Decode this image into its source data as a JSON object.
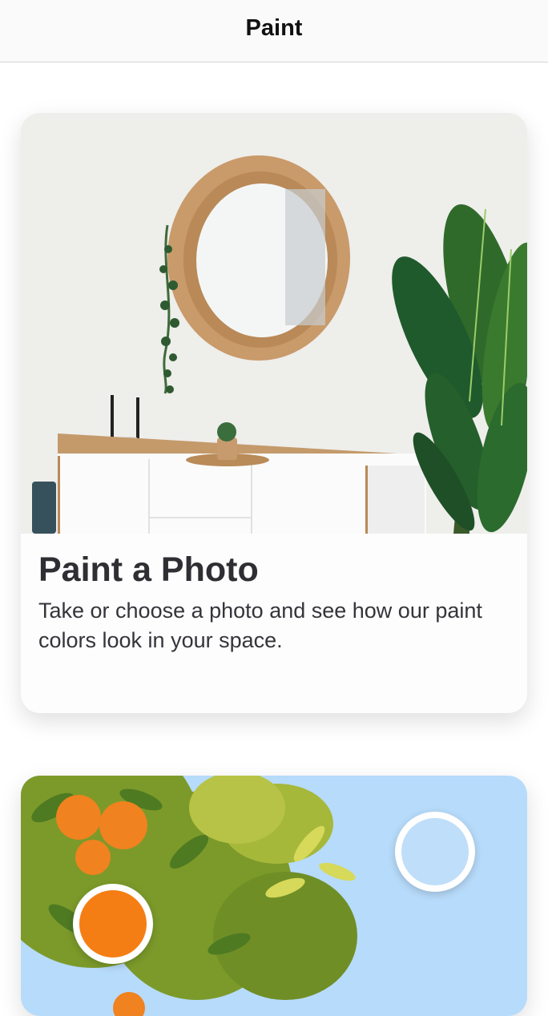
{
  "header": {
    "title": "Paint"
  },
  "cards": [
    {
      "title": "Paint a Photo",
      "description": "Take or choose a photo and see how our paint colors look in your space."
    },
    {
      "swatches": [
        {
          "color": "#f57e14"
        },
        {
          "color": "#bfdef9"
        }
      ]
    }
  ],
  "colors": {
    "wall": "#f1f1ef",
    "sky": "#b7dbfa",
    "wood": "#c99a6a",
    "leaf_dark": "#1f5a2c",
    "foliage": "#7c9a2a"
  }
}
